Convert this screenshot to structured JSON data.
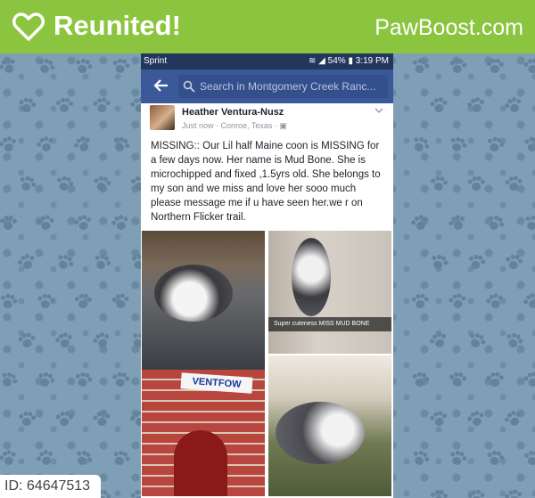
{
  "header": {
    "brand_title": "Reunited!",
    "site_name": "PawBoost.com"
  },
  "colors": {
    "brand_green": "#8bc53f",
    "background_blue": "#7f9fb7",
    "facebook_blue": "#3b5998",
    "status_bar": "#23365c"
  },
  "phone": {
    "status": {
      "carrier": "Sprint",
      "battery": "54%",
      "time": "3:19 PM"
    },
    "search": {
      "placeholder": "Search in Montgomery Creek Ranc..."
    },
    "post": {
      "author": "Heather Ventura-Nusz",
      "meta": "Just now · Conroe, Texas ·",
      "text": "MISSING:: Our Lil half Maine coon is MISSING for a few days now. Her name is Mud Bone. She is microchipped and fixed ,1.5yrs old. She belongs to my son and we miss and love her sooo much please message me if u have seen her.we r on Northern Flicker trail.",
      "photo_caption": "Super cuteness MISS MUD BONE",
      "sign_text": "VENTFOW"
    }
  },
  "listing": {
    "id_label": "ID: 64647513"
  },
  "icons": [
    "heart-icon",
    "back-arrow-icon",
    "search-icon",
    "chevron-down-icon",
    "wifi-icon",
    "signal-icon",
    "battery-icon"
  ]
}
